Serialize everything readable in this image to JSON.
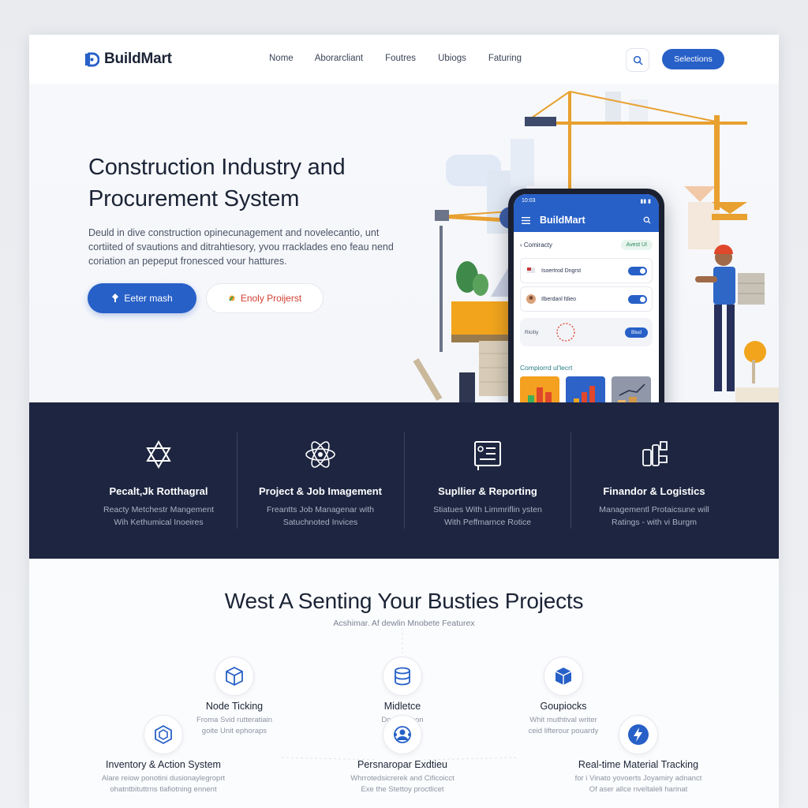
{
  "brand": {
    "name": "BuildMart",
    "accent": "#2760c7",
    "dark": "#1d2540"
  },
  "nav": {
    "links": [
      "Nome",
      "Aborarcliant",
      "Foutres",
      "Ubiogs",
      "Faturing"
    ],
    "cta_label": "Selections",
    "search_icon": "search-icon"
  },
  "hero": {
    "title": "Construction Industry and Procurement System",
    "description": "Deuld in dive construction opinecunagement and novelecantio, unt cortiited of svautions and ditrahtiesory, yvou rracklades eno feau nend coriation an pepeput fronesced vour hattures.",
    "primary_button": "Eeter mash",
    "secondary_button": "Enoly Proijerst"
  },
  "phone": {
    "status_time": "10:03",
    "status_right": "▮▮ ▮",
    "app_title": "BuildMart",
    "section_label": "Comiracty",
    "chip_label": "Avest UI",
    "card1_text": "Isoertrod   Dngrst",
    "card2_text": "Ilberdanl  fdieo",
    "row3_text": "Ricitiy",
    "row3_button": "Blud",
    "tiles_label": "Compiorrd ul'lecrt"
  },
  "features": [
    {
      "title": "Pecalt,Jk Rotthagral",
      "desc_1": "Reacty Metchestr Mangement",
      "desc_2": "Wih Kethumical Inoeires",
      "icon": "star-of-david-icon"
    },
    {
      "title": "Project & Job Imagement",
      "desc_1": "Freantts Job Managenar with",
      "desc_2": "Satuchnoted Invices",
      "icon": "atom-icon"
    },
    {
      "title": "Supllier & Reporting",
      "desc_1": "Stiatues With Limmriflin ysten",
      "desc_2": "With Peffmarnce Rotice",
      "icon": "document-list-icon"
    },
    {
      "title": "Finandor & Logistics",
      "desc_1": "Managementl Protaicsune will",
      "desc_2": "Ratings - with vi Burgm",
      "icon": "tools-icon"
    }
  ],
  "section": {
    "title": "West A Senting Your Busties Projects",
    "subtitle": "Acshimar. Af dewlin Mnobete Featurex",
    "nodes": [
      {
        "title": "Node Ticking",
        "desc_1": "Froma Svid rutteratiain",
        "desc_2": "goite Unit ephoraps",
        "icon": "3d-box-icon"
      },
      {
        "title": "Midletce",
        "desc_1": "Domtlceteon",
        "desc_2": "",
        "icon": "database-icon"
      },
      {
        "title": "Goupiocks",
        "desc_1": "Whit muthtival writer",
        "desc_2": "ceid lifterour pouardy",
        "icon": "cube-icon"
      },
      {
        "title": "Inventory & Action System",
        "desc_1": "Alare reiow ponotini dusionaylegroprt",
        "desc_2": "ohatntbituttrns tlafiotning ennent",
        "icon": "hexagon-icon"
      },
      {
        "title": "Persnaropar Exdtieu",
        "desc_1": "Whrrotedsicrerek and Cificoicct",
        "desc_2": "Exe the Stettoy proctlicet",
        "icon": "support-icon"
      },
      {
        "title": "Real-time Material Tracking",
        "desc_1": "for i Vinato yovoerts Joyamiry adnanct",
        "desc_2": "Of aser allce nveltaleli harinat",
        "icon": "lightning-icon"
      }
    ]
  }
}
